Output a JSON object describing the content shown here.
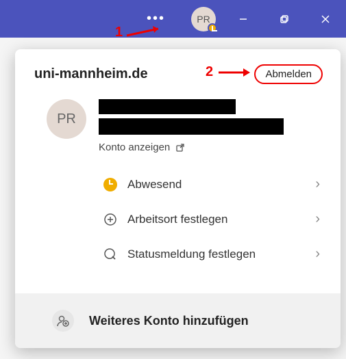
{
  "titlebar": {
    "avatar_initials": "PR"
  },
  "card": {
    "domain": "uni-mannheim.de",
    "signout_label": "Abmelden",
    "avatar_initials": "PR",
    "view_account_label": "Konto anzeigen",
    "menu": [
      {
        "label": "Abwesend"
      },
      {
        "label": "Arbeitsort festlegen"
      },
      {
        "label": "Statusmeldung festlegen"
      }
    ],
    "footer_label": "Weiteres Konto hinzufügen"
  },
  "annotations": {
    "step1": "1",
    "step2": "2"
  }
}
